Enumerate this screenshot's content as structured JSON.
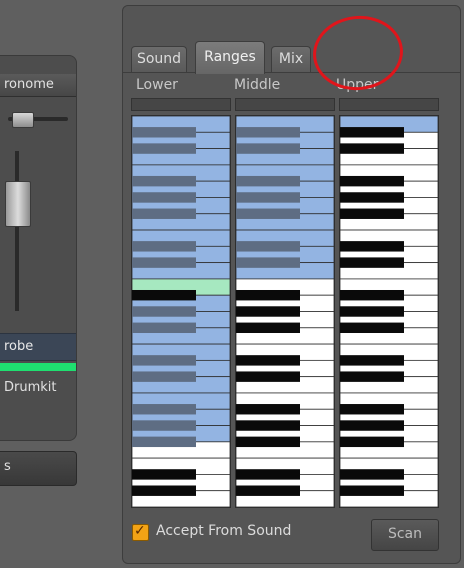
{
  "left_panel": {
    "header_label": "ronome",
    "strobe_label": "robe",
    "drumkit_label": "Drumkit",
    "button_label": "s"
  },
  "tabs": [
    {
      "label": "Sound",
      "active": false
    },
    {
      "label": "Ranges",
      "active": true
    },
    {
      "label": "Mix",
      "active": false
    }
  ],
  "ranges": {
    "columns": [
      {
        "label": "Lower"
      },
      {
        "label": "Middle"
      },
      {
        "label": "Upper"
      }
    ],
    "accept_from_sound": {
      "label": "Accept From Sound",
      "checked": true
    },
    "scan_label": "Scan"
  },
  "colors": {
    "range_highlight": "#93b4e2",
    "range_black_key": "#5e6d83",
    "split_key": "#a6e8c0",
    "annotation": "#e0151b",
    "accent_green": "#1fe070",
    "checkbox": "#f3a315"
  }
}
